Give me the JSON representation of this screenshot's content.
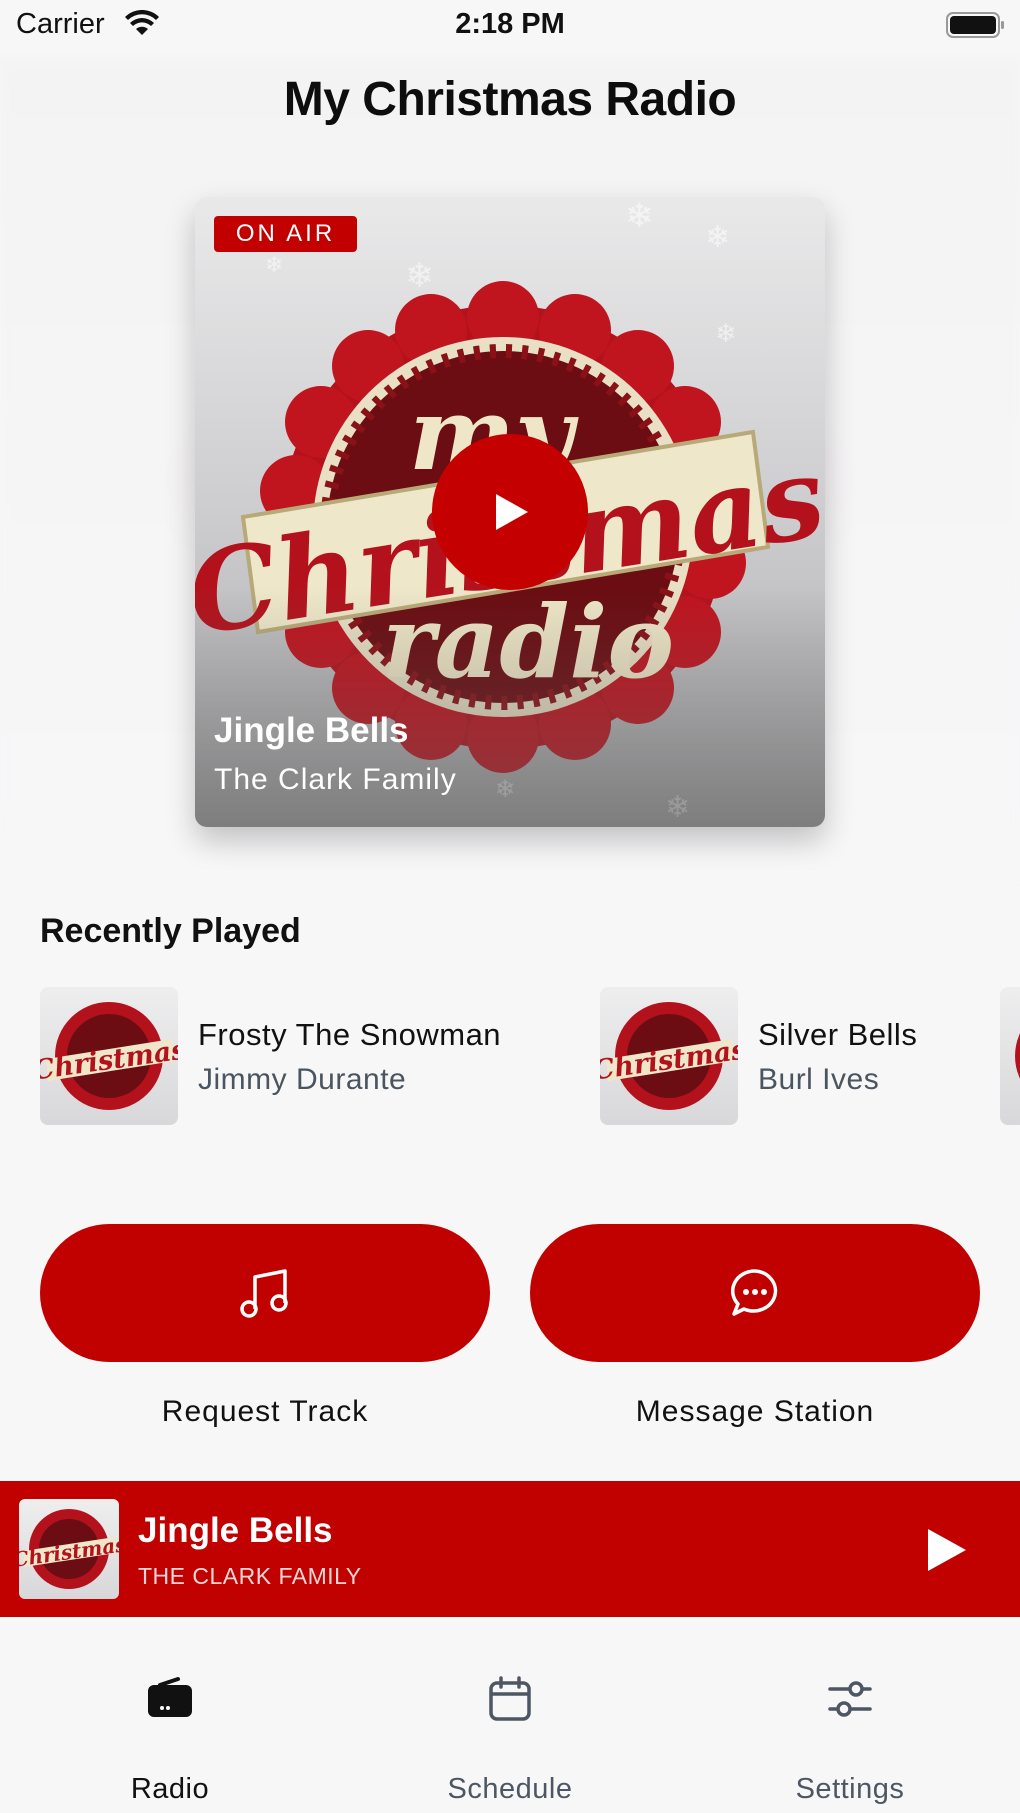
{
  "status_bar": {
    "carrier": "Carrier",
    "time": "2:18 PM"
  },
  "header": {
    "title": "My Christmas Radio"
  },
  "now_playing_card": {
    "badge": "ON AIR",
    "title": "Jingle Bells",
    "artist": "The Clark Family",
    "logo_line1": "my",
    "logo_line2": "Christmas",
    "logo_line3": "radio"
  },
  "recently_played": {
    "title": "Recently Played",
    "items": [
      {
        "title": "Frosty The Snowman",
        "artist": "Jimmy Durante"
      },
      {
        "title": "Silver Bells",
        "artist": "Burl Ives"
      }
    ]
  },
  "actions": {
    "request_label": "Request Track",
    "message_label": "Message Station"
  },
  "mini_player": {
    "title": "Jingle Bells",
    "artist": "THE CLARK FAMILY"
  },
  "tabs": [
    {
      "label": "Radio",
      "icon": "radio-icon",
      "active": true
    },
    {
      "label": "Schedule",
      "icon": "calendar-icon",
      "active": false
    },
    {
      "label": "Settings",
      "icon": "sliders-icon",
      "active": false
    }
  ],
  "colors": {
    "accent": "#c10000",
    "active_tab": "#111111",
    "inactive_tab": "#4d5763"
  }
}
